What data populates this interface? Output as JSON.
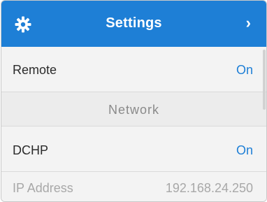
{
  "header": {
    "icon": "gear-icon",
    "title": "Settings",
    "chevron": "›",
    "background": "#1e7fd6"
  },
  "rows": {
    "remote": {
      "label": "Remote",
      "value": "On"
    },
    "network_section": {
      "label": "Network"
    },
    "dhcp": {
      "label": "DCHP",
      "value": "On"
    },
    "ip": {
      "label": "IP Address",
      "value": "192.168.24.250"
    }
  },
  "colors": {
    "accent": "#1e7fd6",
    "muted": "#a8a8a8"
  }
}
